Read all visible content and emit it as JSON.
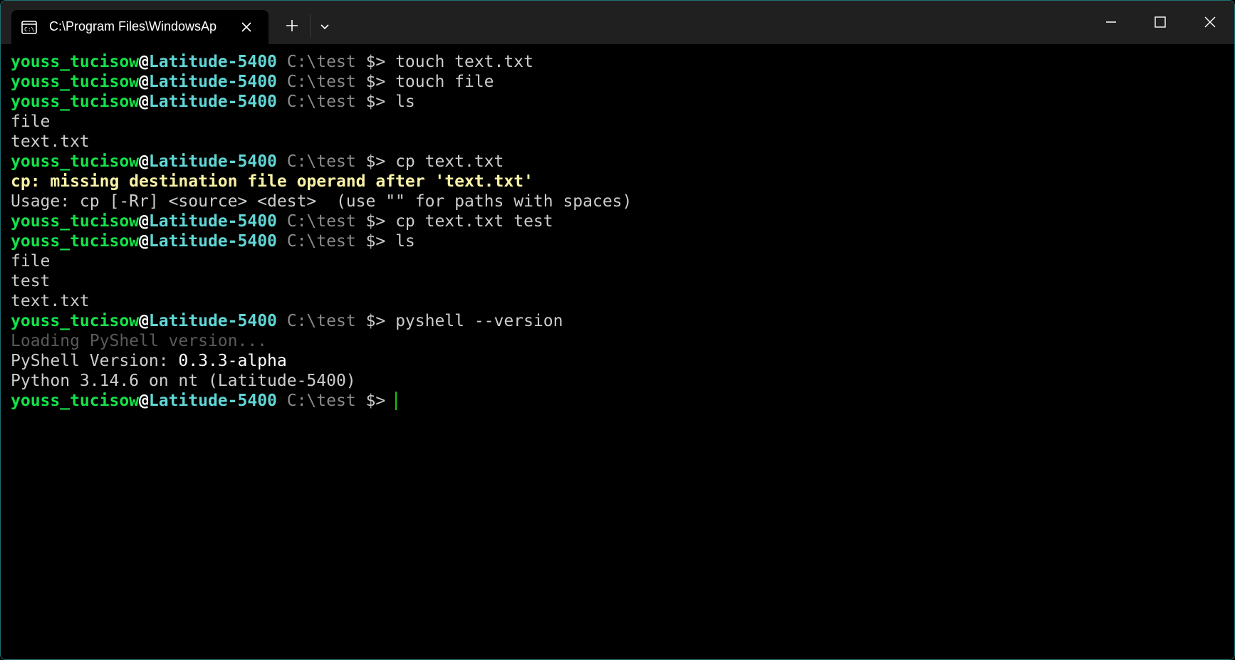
{
  "window": {
    "tab_title": "C:\\Program Files\\WindowsAp",
    "tab_icon": "terminal-prompt-icon",
    "accent_color": "#1f6f73"
  },
  "prompt": {
    "user": "youss_tucisow",
    "at": "@",
    "host": "Latitude-5400",
    "path": " C:\\test ",
    "symbol": "$> "
  },
  "lines": [
    {
      "type": "prompt",
      "command": "touch text.txt"
    },
    {
      "type": "prompt",
      "command": "touch file"
    },
    {
      "type": "prompt",
      "command": "ls"
    },
    {
      "type": "output",
      "text": "file"
    },
    {
      "type": "output",
      "text": "text.txt"
    },
    {
      "type": "prompt",
      "command": "cp text.txt"
    },
    {
      "type": "error",
      "text": "cp: missing destination file operand after 'text.txt'"
    },
    {
      "type": "output",
      "text": "Usage: cp [-Rr] <source> <dest>  (use \"\" for paths with spaces)"
    },
    {
      "type": "prompt",
      "command": "cp text.txt test"
    },
    {
      "type": "prompt",
      "command": "ls"
    },
    {
      "type": "output",
      "text": "file"
    },
    {
      "type": "output",
      "text": "test"
    },
    {
      "type": "output",
      "text": "text.txt"
    },
    {
      "type": "prompt",
      "command": "pyshell --version"
    },
    {
      "type": "dim",
      "text": "Loading PyShell version..."
    },
    {
      "type": "version",
      "label": "PyShell Version: ",
      "value": "0.3.3-alpha"
    },
    {
      "type": "output",
      "text": "Python 3.14.6 on nt (Latitude-5400)"
    },
    {
      "type": "prompt",
      "command": "",
      "cursor": true
    }
  ],
  "colors": {
    "user": "#13e349",
    "host": "#61d6d6",
    "path": "#8a8a8a",
    "error": "#f9f1a5",
    "dim": "#5a5a5a",
    "cursor": "#16c60c",
    "background": "#000000",
    "titlebar": "#202020"
  }
}
